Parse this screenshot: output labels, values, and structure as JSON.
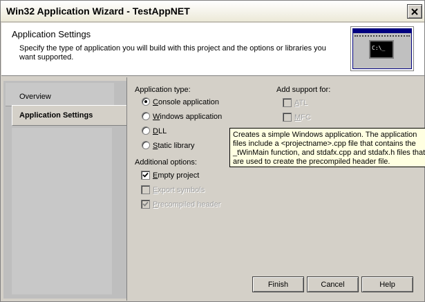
{
  "window": {
    "title": "Win32 Application Wizard - TestAppNET"
  },
  "header": {
    "title": "Application Settings",
    "description": "Specify the type of application you will build with this project and the options or libraries you want supported.",
    "image_prompt": "C:\\_"
  },
  "nav": {
    "items": [
      {
        "label": "Overview",
        "active": false
      },
      {
        "label": "Application Settings",
        "active": true
      }
    ]
  },
  "application_type": {
    "heading": "Application type:",
    "options": [
      {
        "prefix": "",
        "accel": "C",
        "rest": "onsole application",
        "selected": true
      },
      {
        "prefix": "",
        "accel": "W",
        "rest": "indows application",
        "selected": false
      },
      {
        "prefix": "",
        "accel": "D",
        "rest": "LL",
        "selected": false
      },
      {
        "prefix": "",
        "accel": "S",
        "rest": "tatic library",
        "selected": false
      }
    ]
  },
  "additional_options": {
    "heading": "Additional options:",
    "options": [
      {
        "prefix": "",
        "accel": "E",
        "rest": "mpty project",
        "checked": true,
        "enabled": true
      },
      {
        "prefix": "",
        "accel": "E",
        "rest": "xport symbols",
        "checked": false,
        "enabled": false
      },
      {
        "prefix": "",
        "accel": "P",
        "rest": "recompiled header",
        "checked": true,
        "enabled": false
      }
    ]
  },
  "add_support": {
    "heading": "Add support for:",
    "options": [
      {
        "prefix": "",
        "accel": "A",
        "rest": "TL",
        "checked": false,
        "enabled": false
      },
      {
        "prefix": "",
        "accel": "M",
        "rest": "FC",
        "checked": false,
        "enabled": false
      }
    ]
  },
  "tooltip": {
    "text": "Creates a simple Windows application. The application files include a <projectname>.cpp file that contains the _tWinMain function, and stdafx.cpp and stdafx.h files that are used to create the precompiled header file."
  },
  "buttons": {
    "finish": "Finish",
    "cancel": "Cancel",
    "help": "Help"
  },
  "icons": {
    "close": "close-icon",
    "console": "console-window-icon"
  }
}
